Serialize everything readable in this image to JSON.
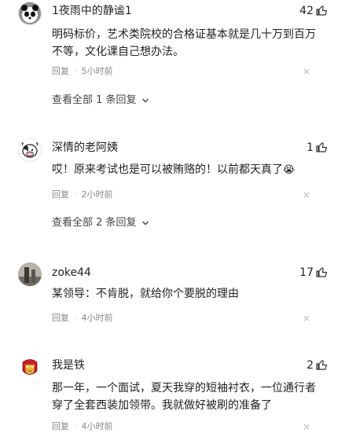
{
  "comments": [
    {
      "username": "1夜雨中的静谧1",
      "likes": "42",
      "text": "明码标价，艺术类院校的合格证基本就是几十万到百万不等，文化课自己想办法。",
      "reply_label": "回复",
      "time": "5小时前",
      "view_all": "查看全部 1 条回复",
      "avatar_icon": "panda-avatar"
    },
    {
      "username": "深情的老阿姨",
      "likes": "1",
      "text": "哎！原来考试也是可以被贿赂的！以前都天真了",
      "emoji": "😭",
      "reply_label": "回复",
      "time": "2小时前",
      "view_all": "查看全部 2 条回复",
      "avatar_icon": "cow-avatar"
    },
    {
      "username": "zoke44",
      "likes": "17",
      "text": "某领导：不肯脱，就给你个要脱的理由",
      "reply_label": "回复",
      "time": "4小时前",
      "avatar_icon": "photo-avatar"
    },
    {
      "username": "我是铁",
      "likes": "2",
      "text": "那一年，一个面试，夏天我穿的短袖衬衣，一位通行者穿了全套西装加领带。我就做好被刷的准备了",
      "reply_label": "回复",
      "time": "4小时前",
      "avatar_icon": "ironman-avatar"
    }
  ],
  "separator": "·",
  "close_glyph": "×",
  "colors": {
    "text": "#222222",
    "meta": "#888888",
    "close": "#bbbbbb"
  }
}
